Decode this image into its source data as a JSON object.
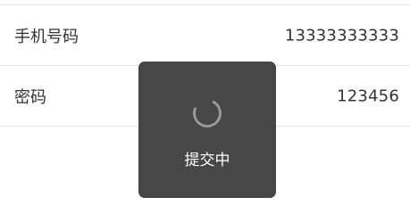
{
  "form": {
    "rows": [
      {
        "label": "手机号码",
        "value": "13333333333"
      },
      {
        "label": "密码",
        "value": "123456"
      }
    ]
  },
  "toast": {
    "icon": "loading-spinner-icon",
    "text": "提交中"
  },
  "colors": {
    "text": "#333333",
    "divider": "#e6e6e6",
    "toast_background": "#333333",
    "toast_text": "#ffffff"
  }
}
